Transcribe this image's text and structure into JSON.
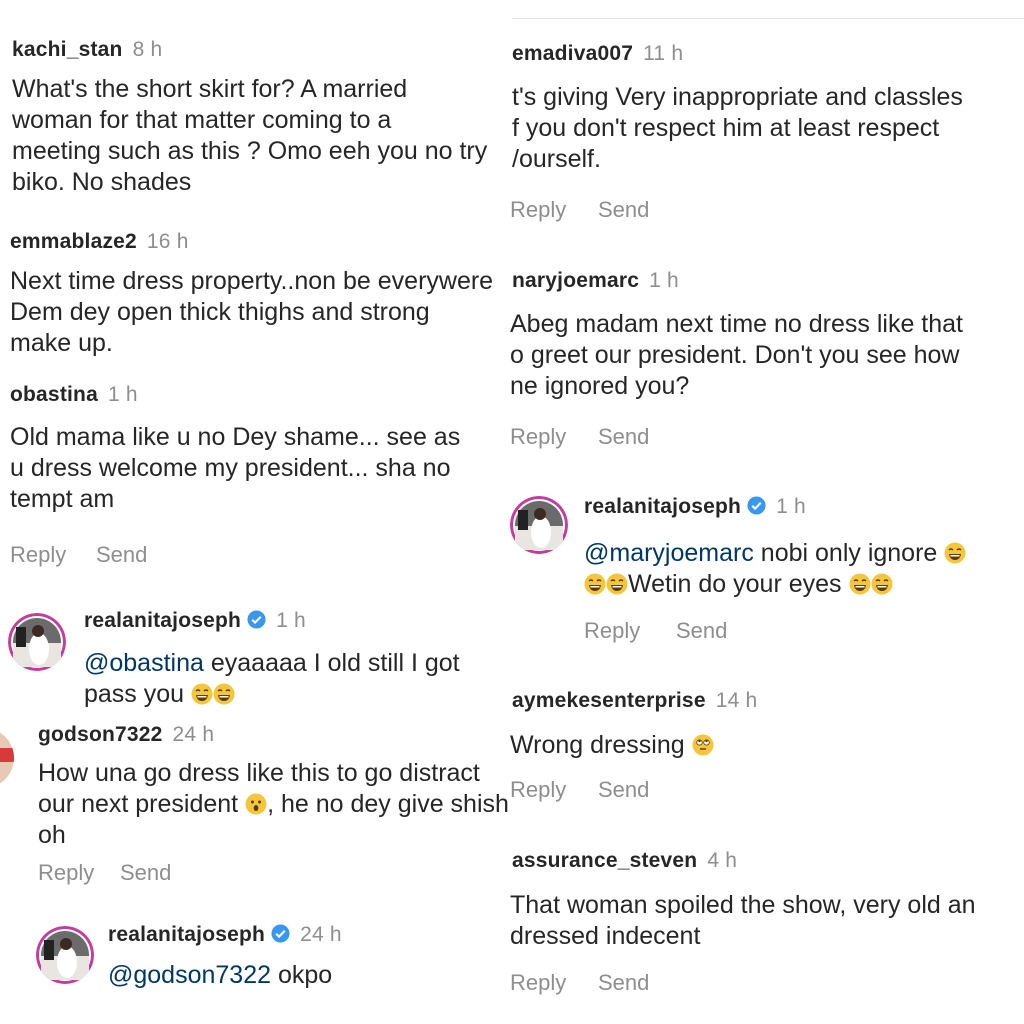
{
  "left": {
    "c1": {
      "user": "kachi_stan",
      "time": "8 h",
      "lines": [
        "What's the short skirt for? A married",
        "woman for that matter coming to a",
        "meeting such as this ? Omo eeh you no try",
        "biko. No shades"
      ]
    },
    "c2": {
      "user": "emmablaze2",
      "time": "16 h",
      "lines": [
        "Next time dress property..non be everywere",
        "Dem dey open thick thighs and strong",
        "make up."
      ]
    },
    "c3": {
      "user": "obastina",
      "time": "1 h",
      "lines": [
        "Old mama like u no Dey shame... see as",
        "u dress welcome my president... sha no",
        "tempt am"
      ],
      "reply": "Reply",
      "send": "Send"
    },
    "r1": {
      "user": "realanitajoseph",
      "time": "1 h",
      "mention": "@obastina",
      "line1": " eyaaaaa I old still I got",
      "line2": "pass you"
    },
    "c4": {
      "user": "godson7322",
      "time": "24 h",
      "line1": "How una go dress like this to go distract",
      "line2a": "our next president",
      "line2b": ", he no dey give shish",
      "line3": "oh",
      "reply": "Reply",
      "send": "Send"
    },
    "r2": {
      "user": "realanitajoseph",
      "time": "24 h",
      "mention": "@godson7322",
      "text": " okpo"
    }
  },
  "right": {
    "c1": {
      "user": "emadiva007",
      "time": "11 h",
      "lines": [
        "t's giving Very inappropriate and classles",
        "f you don't respect him at least respect",
        "/ourself."
      ],
      "reply": "Reply",
      "send": "Send"
    },
    "c2": {
      "user": "naryjoemarc",
      "time": "1 h",
      "lines": [
        "Abeg madam next time no dress like that",
        "o greet our president. Don't you see how",
        "ne ignored you?"
      ],
      "reply": "Reply",
      "send": "Send"
    },
    "r1": {
      "user": "realanitajoseph",
      "time": "1 h",
      "mention": "@maryjoemarc",
      "line1": " nobi only ignore",
      "line2": "Wetin do your eyes",
      "reply": "Reply",
      "send": "Send"
    },
    "c3": {
      "user": "aymekesenterprise",
      "time": "14 h",
      "text": "Wrong dressing",
      "reply": "Reply",
      "send": "Send"
    },
    "c4": {
      "user": "assurance_steven",
      "time": "4 h",
      "lines": [
        "That woman spoiled the show, very old an",
        "dressed indecent"
      ],
      "reply": "Reply",
      "send": "Send"
    }
  },
  "colors": {
    "verified": "#3897f0",
    "mention": "#00376b",
    "meta": "#8e8e8e",
    "emoji": "#f5c53a"
  },
  "icons": [
    "verified-badge-icon",
    "laughing-emoji-icon",
    "surprised-emoji-icon",
    "eye-roll-emoji-icon",
    "avatar"
  ]
}
